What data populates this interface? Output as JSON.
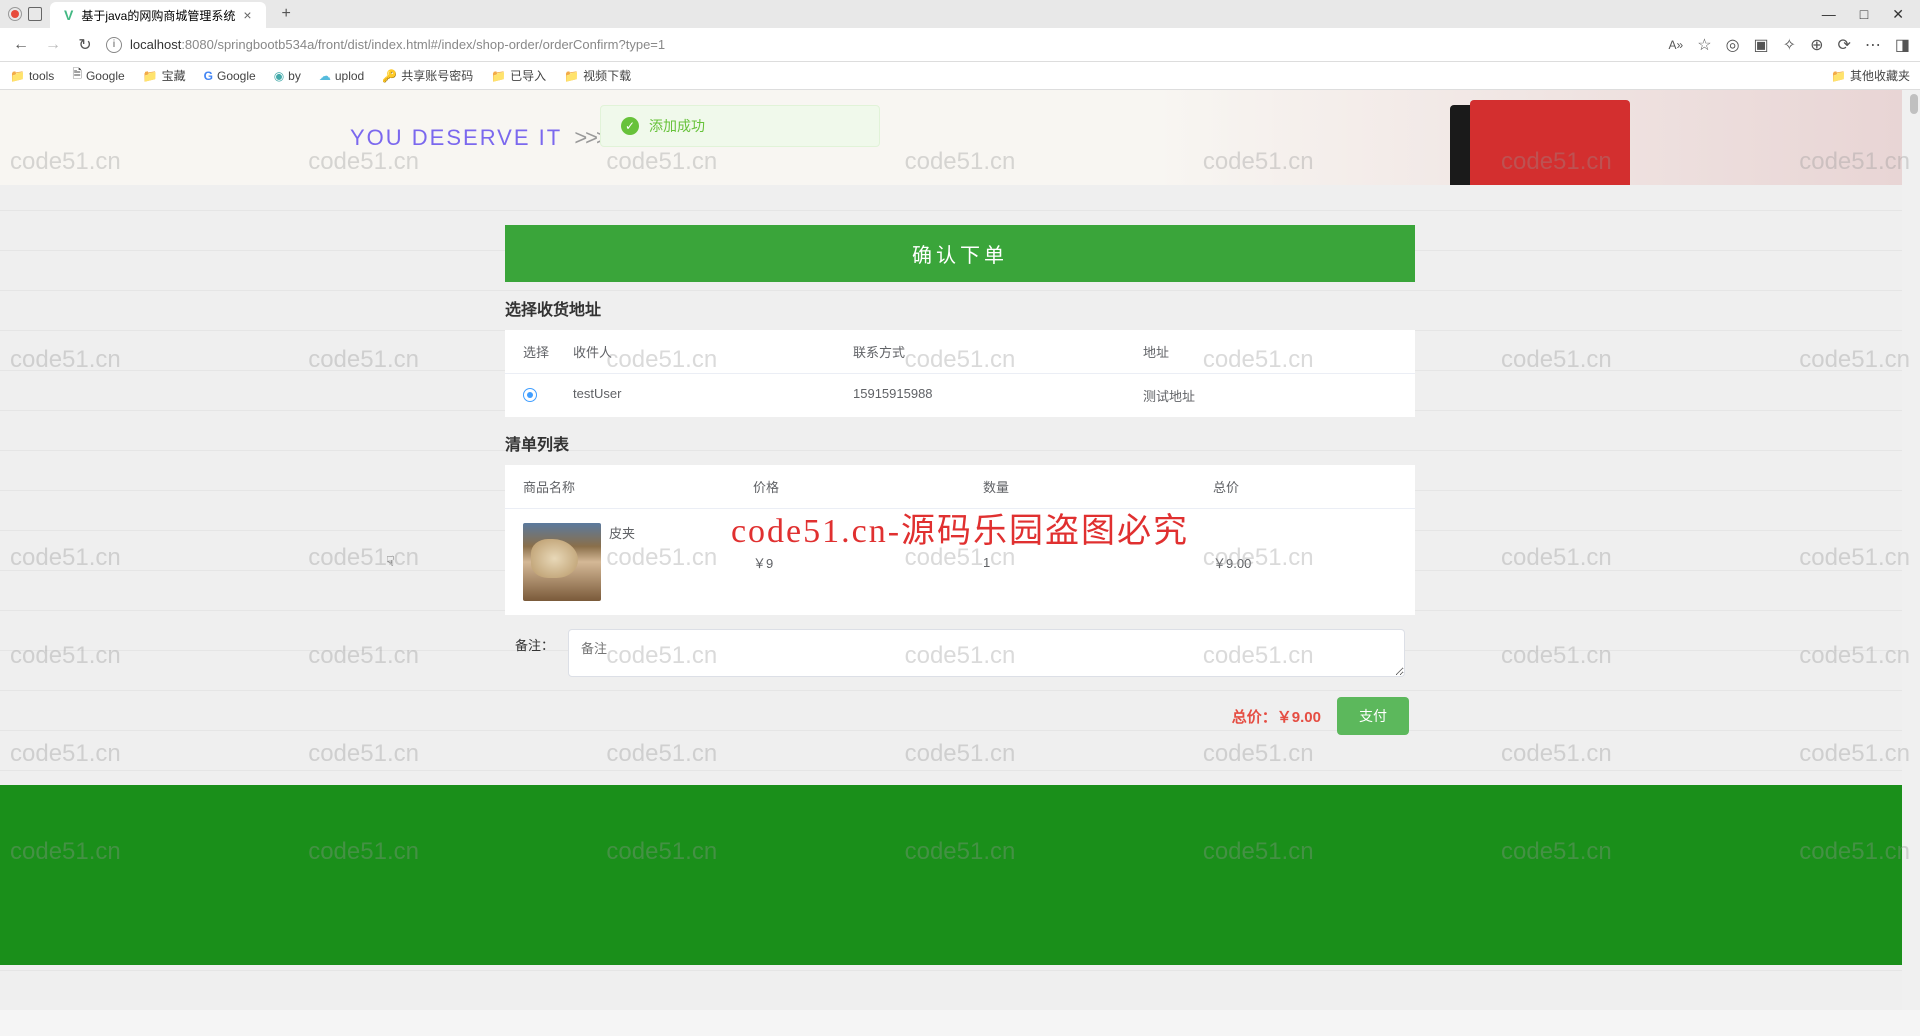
{
  "browser": {
    "tab_title": "基于java的网购商城管理系统",
    "url_host": "localhost",
    "url_path": ":8080/springbootb534a/front/dist/index.html#/index/shop-order/orderConfirm?type=1",
    "new_tab": "+",
    "close": "×",
    "win_min": "—",
    "win_max": "□",
    "win_close": "✕"
  },
  "bookmarks": {
    "items": [
      {
        "icon": "folder",
        "label": "tools"
      },
      {
        "icon": "page",
        "label": "Google"
      },
      {
        "icon": "folder",
        "label": "宝藏"
      },
      {
        "icon": "g",
        "label": "Google"
      },
      {
        "icon": "by",
        "label": "by"
      },
      {
        "icon": "uplod",
        "label": "uplod"
      },
      {
        "icon": "key",
        "label": "共享账号密码"
      },
      {
        "icon": "folder",
        "label": "已导入"
      },
      {
        "icon": "folder",
        "label": "视频下载"
      }
    ],
    "right": "其他收藏夹"
  },
  "banner": {
    "text": "YOU DESERVE IT"
  },
  "toast": {
    "message": "添加成功"
  },
  "main": {
    "header": "确认下单",
    "address_section": "选择收货地址",
    "address_headers": {
      "select": "选择",
      "recipient": "收件人",
      "phone": "联系方式",
      "addr": "地址"
    },
    "address_row": {
      "recipient": "testUser",
      "phone": "15915915988",
      "addr": "测试地址"
    },
    "items_section": "清单列表",
    "items_headers": {
      "name": "商品名称",
      "price": "价格",
      "qty": "数量",
      "total": "总价"
    },
    "items_row": {
      "name": "皮夹",
      "price": "￥9",
      "qty": "1",
      "total": "￥9.00"
    },
    "remark_label": "备注：",
    "remark_placeholder": "备注",
    "total_label": "总价：",
    "total_value": "￥9.00",
    "pay_button": "支付"
  },
  "watermark": {
    "text": "code51.cn",
    "center": "code51.cn-源码乐园盗图必究"
  }
}
